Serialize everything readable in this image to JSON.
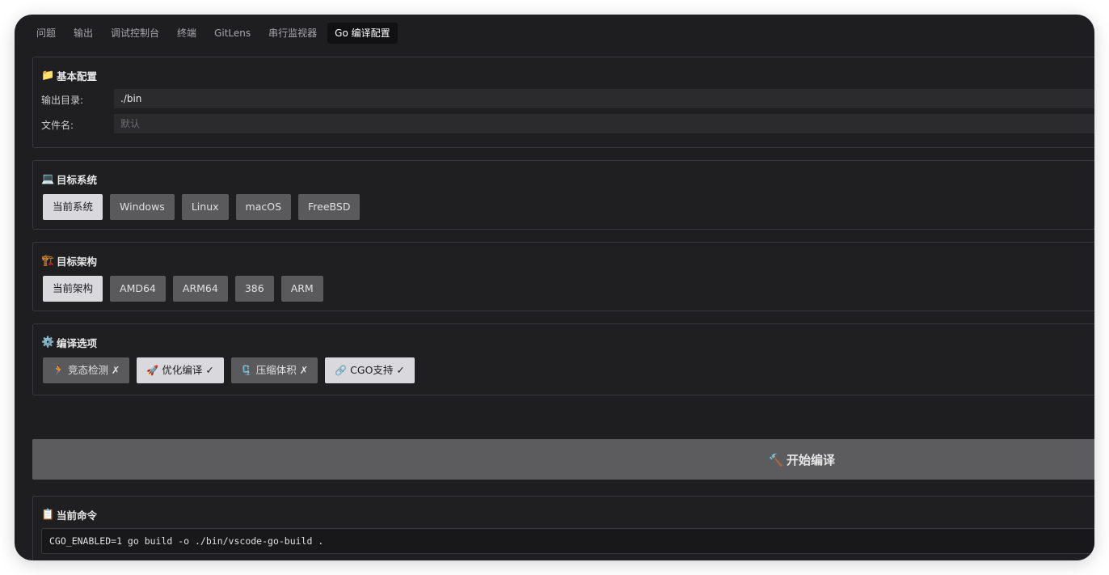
{
  "tabs": [
    {
      "label": "问题",
      "active": false
    },
    {
      "label": "输出",
      "active": false
    },
    {
      "label": "调试控制台",
      "active": false
    },
    {
      "label": "终端",
      "active": false
    },
    {
      "label": "GitLens",
      "active": false
    },
    {
      "label": "串行监视器",
      "active": false
    },
    {
      "label": "Go 编译配置",
      "active": true
    }
  ],
  "basic": {
    "icon": "📁",
    "title": "基本配置",
    "output_dir_label": "输出目录:",
    "output_dir_value": "./bin",
    "filename_label": "文件名:",
    "filename_placeholder": "默认"
  },
  "target_os": {
    "icon": "💻",
    "title": "目标系统",
    "options": [
      {
        "label": "当前系统",
        "selected": true
      },
      {
        "label": "Windows",
        "selected": false
      },
      {
        "label": "Linux",
        "selected": false
      },
      {
        "label": "macOS",
        "selected": false
      },
      {
        "label": "FreeBSD",
        "selected": false
      }
    ]
  },
  "target_arch": {
    "icon": "🏗️",
    "title": "目标架构",
    "options": [
      {
        "label": "当前架构",
        "selected": true
      },
      {
        "label": "AMD64",
        "selected": false
      },
      {
        "label": "ARM64",
        "selected": false
      },
      {
        "label": "386",
        "selected": false
      },
      {
        "label": "ARM",
        "selected": false
      }
    ]
  },
  "compile_options": {
    "icon": "⚙️",
    "title": "编译选项",
    "options": [
      {
        "icon": "🏃",
        "label": "竞态检测 ✗",
        "enabled": false
      },
      {
        "icon": "🚀",
        "label": "优化编译 ✓",
        "enabled": true
      },
      {
        "icon": "🗜️",
        "label": "压缩体积 ✗",
        "enabled": false
      },
      {
        "icon": "🔗",
        "label": "CGO支持 ✓",
        "enabled": true
      }
    ]
  },
  "build": {
    "icon": "🔨",
    "label": "开始编译"
  },
  "current_command": {
    "icon": "📋",
    "title": "当前命令",
    "command": "CGO_ENABLED=1 go build -o ./bin/vscode-go-build ."
  },
  "colors": {
    "window_bg": "#1e1e20",
    "button": "#5a5a5d",
    "button_selected": "#d9d9dd",
    "input_bg": "#2b2b2e"
  }
}
